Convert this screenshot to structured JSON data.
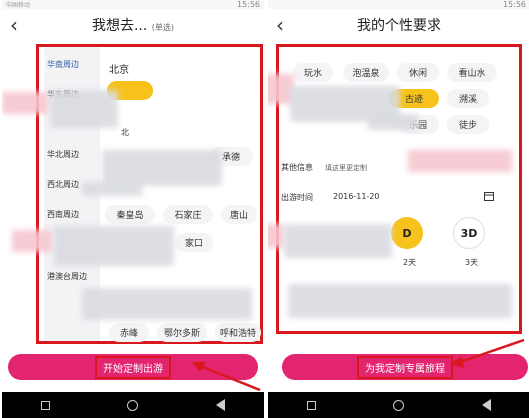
{
  "status": {
    "carrier_left": "中国移动",
    "time_left": "15:56",
    "time_right": "15:56"
  },
  "left": {
    "title": "我想去...",
    "subtitle": "(单选)",
    "sidebar": [
      "华南周边",
      "华东周边",
      "",
      "华北周边",
      "西北周边",
      "西南周边",
      "",
      "港澳台周边"
    ],
    "city_header": "北京",
    "cities": [
      "承德",
      "秦皇岛",
      "石家庄",
      "唐山",
      "家口",
      "赤峰",
      "鄂尔多斯",
      "呼和浩特",
      "北"
    ],
    "button": "开始定制出游"
  },
  "right": {
    "title": "我的个性要求",
    "tags": [
      "玩水",
      "泡温泉",
      "休闲",
      "看山水",
      "古迹",
      "溯溪",
      "乐园",
      "徒步"
    ],
    "other_label": "其他信息",
    "other_placeholder": "填这里更定制",
    "date_label": "出游时间",
    "date_value": "2016-11-20",
    "days": [
      "D",
      "3D"
    ],
    "day_labels": [
      "2天",
      "3天"
    ],
    "button": "为我定制专属旅程"
  },
  "colors": {
    "accent": "#e3246e",
    "highlight": "#f6c21b",
    "box": "#d9181e"
  }
}
